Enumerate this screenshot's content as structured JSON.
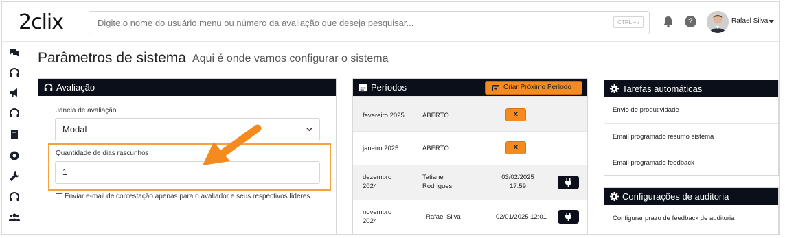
{
  "header": {
    "logo_text": "2clix",
    "search_placeholder": "Digite o nome do usuário,menu ou número da avaliação que deseja pesquisar...",
    "shortcut_hint": "CTRL + /",
    "help_label": "?",
    "user_name": "Rafael Silva"
  },
  "sidebar": {
    "icons": [
      "chat-icon",
      "headset-icon",
      "megaphone-icon",
      "headset-icon",
      "book-icon",
      "brain-icon",
      "wrench-icon",
      "headset-icon",
      "users-icon"
    ]
  },
  "page": {
    "title": "Parâmetros de sistema",
    "subtitle": "Aqui é onde vamos configurar o sistema"
  },
  "avaliacao": {
    "title": "Avaliação",
    "janela_label": "Janela de avaliação",
    "janela_value": "Modal",
    "quantidade_label": "Quantidade de dias rascunhos",
    "quantidade_value": "1",
    "checkbox_label": "Enviar e-mail de contestação apenas para o avaliador e seus respectivos líderes",
    "checkbox_checked": false
  },
  "periodos": {
    "title": "Períodos",
    "create_button": "Criar Próximo Período",
    "rows": [
      {
        "period": "fevereiro 2025",
        "status": "ABERTO",
        "action": "×"
      },
      {
        "period": "janeiro 2025",
        "status": "ABERTO",
        "action": "×"
      },
      {
        "period_line1": "dezembro",
        "period_line2": "2024",
        "user_line1": "Tatiane",
        "user_line2": "Rodrigues",
        "date_line1": "03/02/2025",
        "date_line2": "17:59"
      },
      {
        "period_line1": "novembro",
        "period_line2": "2024",
        "user": "Rafael Silva",
        "date": "02/01/2025 12:01"
      }
    ]
  },
  "tarefas": {
    "title": "Tarefas automáticas",
    "items": [
      "Envio de produtividade",
      "Email programado resumo sistema",
      "Email programado feedback"
    ]
  },
  "auditoria": {
    "title": "Configurações de auditoria",
    "items": [
      "Configurar prazo de feedback de auditoria"
    ]
  },
  "colors": {
    "header_dark": "#0b0f1a",
    "accent_orange": "#f58a1f",
    "highlight_border": "#f5a33c"
  }
}
